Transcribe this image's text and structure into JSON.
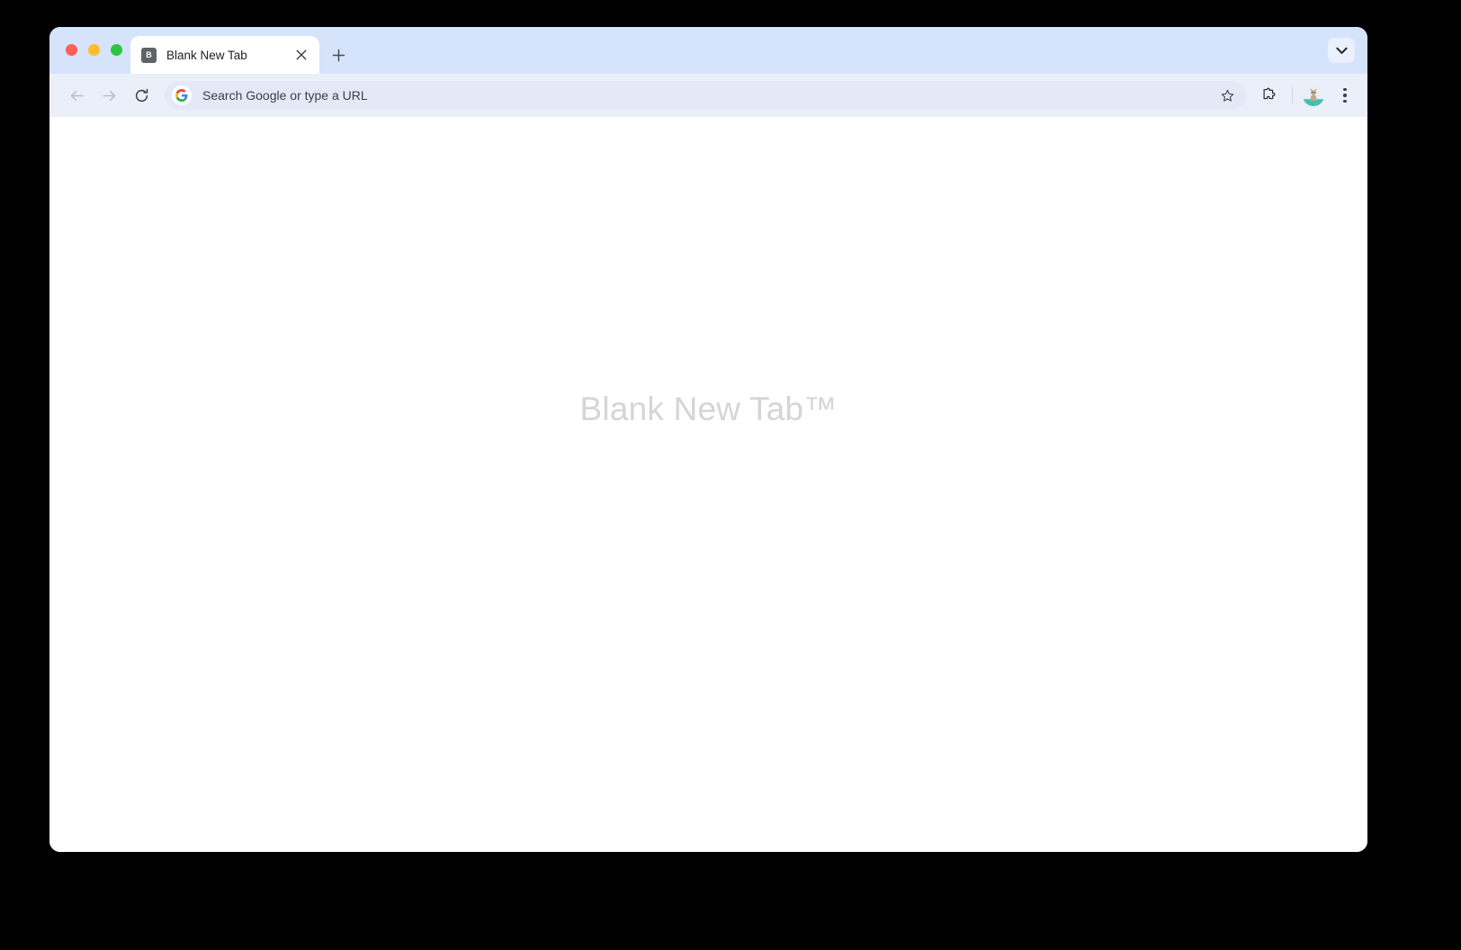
{
  "window": {
    "traffic_lights": [
      {
        "name": "close",
        "color": "#ff5f57"
      },
      {
        "name": "minimize",
        "color": "#febc2e"
      },
      {
        "name": "zoom",
        "color": "#2ac840"
      }
    ]
  },
  "tabstrip": {
    "background_color": "#d5e3fb",
    "tabs": [
      {
        "favicon_letter": "B",
        "favicon_bg": "#5f6368",
        "title": "Blank New Tab",
        "active": true,
        "close_icon": "close-icon"
      }
    ],
    "new_tab_icon": "plus-icon",
    "tab_search_icon": "chevron-down-icon"
  },
  "toolbar": {
    "background_color": "#ebeffa",
    "back_icon": "arrow-left-icon",
    "forward_icon": "arrow-right-icon",
    "reload_icon": "reload-icon",
    "omnibox": {
      "placeholder": "Search Google or type a URL",
      "value": "",
      "leading_icon": "google-g-icon",
      "bookmark_icon": "star-icon",
      "background_color": "#e3e9f6"
    },
    "extensions_icon": "puzzle-piece-icon",
    "profile_icon": "avatar-cat-icon",
    "menu_icon": "three-dot-menu-icon"
  },
  "page": {
    "background_color": "#ffffff",
    "heading": "Blank New Tab™",
    "heading_color": "#d5d5d5"
  }
}
